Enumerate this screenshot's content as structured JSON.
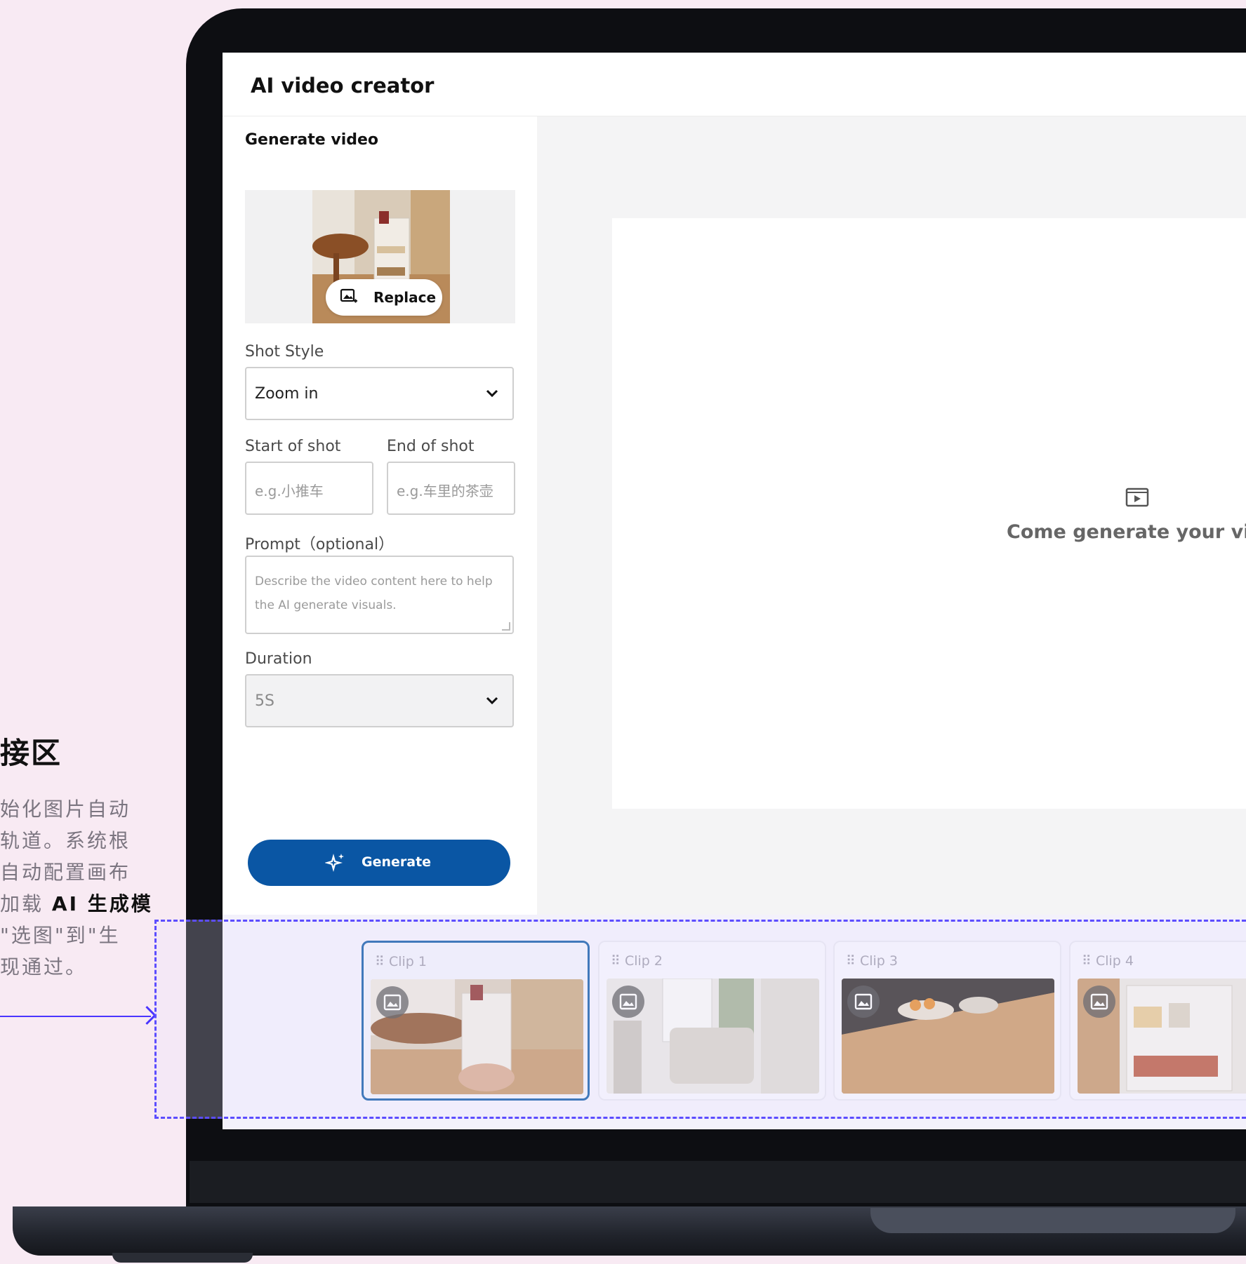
{
  "annotation": {
    "title": "接区",
    "lines": [
      "始化图片自动",
      "轨道。系统根",
      "自动配置画布",
      "加载",
      "AI 生成模",
      "\"选图\"到\"生",
      "现通过。"
    ]
  },
  "app": {
    "title": "AI video creator"
  },
  "sidebar": {
    "title": "Generate video",
    "replace_label": "Replace",
    "shot_style": {
      "label": "Shot Style",
      "value": "Zoom in"
    },
    "start_of_shot": {
      "label": "Start of shot",
      "placeholder": "e.g.小推车"
    },
    "end_of_shot": {
      "label": "End of shot",
      "placeholder": "e.g.车里的茶壶"
    },
    "prompt": {
      "label": "Prompt（optional）",
      "placeholder": "Describe the video content here to help the AI generate visuals."
    },
    "duration": {
      "label": "Duration",
      "value": "5S"
    },
    "generate_label": "Generate"
  },
  "preview": {
    "empty_text": "Come generate your vide"
  },
  "timeline": {
    "clips": [
      {
        "label": "⠿ Clip 1",
        "selected": true
      },
      {
        "label": "⠿ Clip 2",
        "selected": false
      },
      {
        "label": "⠿ Clip 3",
        "selected": false
      },
      {
        "label": "⠿ Clip 4",
        "selected": false
      }
    ]
  },
  "colors": {
    "accent": "#0a56a4",
    "annotation": "#5c4dff",
    "background": "#f8eaf3"
  }
}
